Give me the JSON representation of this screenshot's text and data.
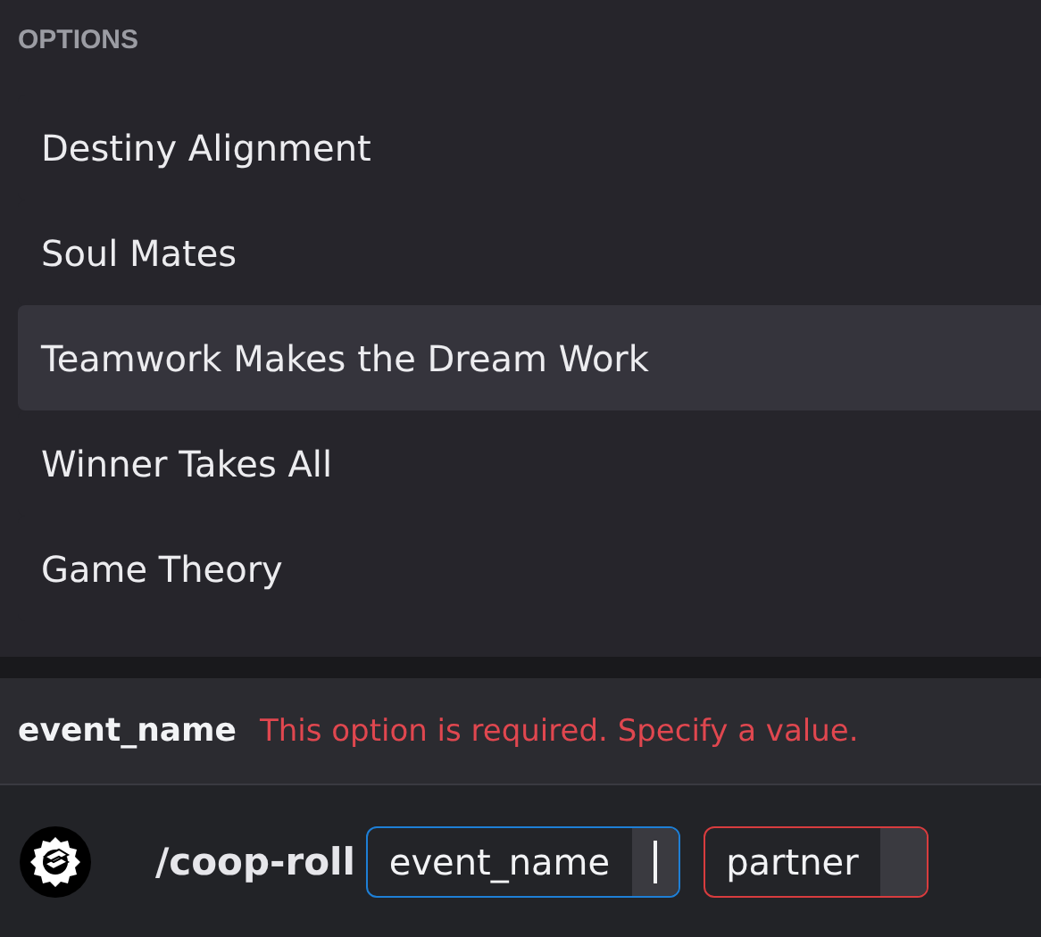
{
  "options_header": "OPTIONS",
  "options": [
    {
      "label": "Destiny Alignment",
      "selected": false
    },
    {
      "label": "Soul Mates",
      "selected": false
    },
    {
      "label": "Teamwork Makes the Dream Work",
      "selected": true
    },
    {
      "label": "Winner Takes All",
      "selected": false
    },
    {
      "label": "Game Theory",
      "selected": false
    }
  ],
  "error_bar": {
    "option_name": "event_name",
    "message": "This option is required. Specify a value."
  },
  "command": {
    "name": "/coop-roll",
    "fields": [
      {
        "label": "event_name",
        "focused": true,
        "invalid": false
      },
      {
        "label": "partner",
        "focused": false,
        "invalid": true
      }
    ]
  }
}
